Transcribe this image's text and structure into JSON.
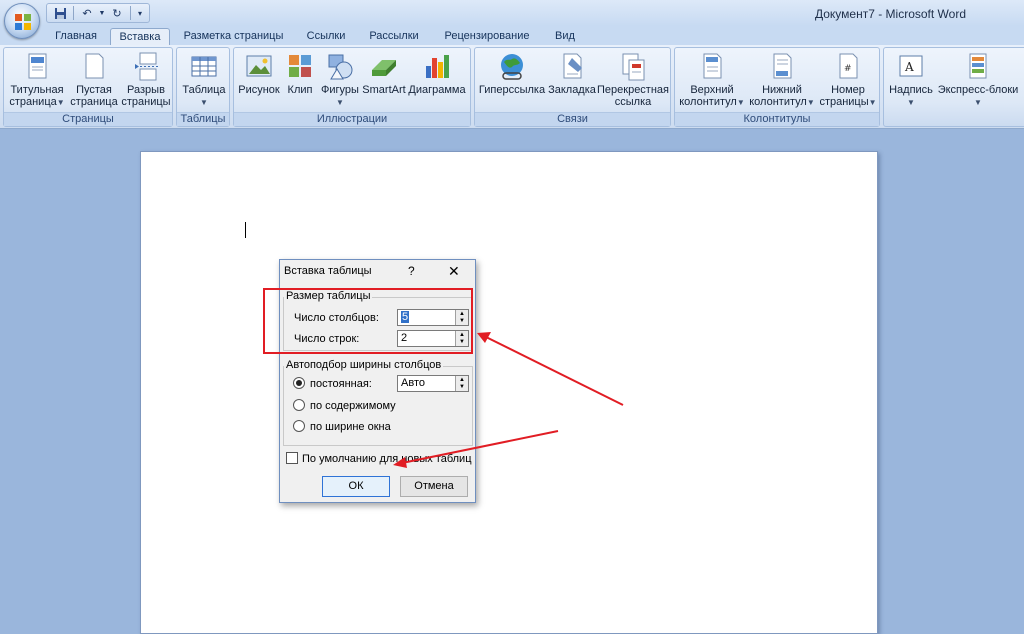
{
  "window": {
    "title": "Документ7 - Microsoft Word"
  },
  "qat": {
    "items": [
      "save-icon",
      "undo-icon",
      "redo-icon",
      "customize-icon"
    ]
  },
  "tabs": [
    {
      "label": "Главная"
    },
    {
      "label": "Вставка",
      "active": true
    },
    {
      "label": "Разметка страницы"
    },
    {
      "label": "Ссылки"
    },
    {
      "label": "Рассылки"
    },
    {
      "label": "Рецензирование"
    },
    {
      "label": "Вид"
    }
  ],
  "ribbon": {
    "groups": [
      {
        "label": "Страницы",
        "buttons": [
          {
            "line1": "Титульная",
            "line2": "страница",
            "icon": "cover-page-icon",
            "dropdown": true
          },
          {
            "line1": "Пустая",
            "line2": "страница",
            "icon": "blank-page-icon"
          },
          {
            "line1": "Разрыв",
            "line2": "страницы",
            "icon": "page-break-icon"
          }
        ]
      },
      {
        "label": "Таблицы",
        "buttons": [
          {
            "line1": "Таблица",
            "line2": "",
            "icon": "table-icon",
            "dropdown": true
          }
        ]
      },
      {
        "label": "Иллюстрации",
        "buttons": [
          {
            "line1": "Рисунок",
            "icon": "picture-icon"
          },
          {
            "line1": "Клип",
            "icon": "clip-icon"
          },
          {
            "line1": "Фигуры",
            "icon": "shapes-icon",
            "dropdown": true
          },
          {
            "line1": "SmartArt",
            "icon": "smartart-icon"
          },
          {
            "line1": "Диаграмма",
            "icon": "chart-icon"
          }
        ]
      },
      {
        "label": "Связи",
        "buttons": [
          {
            "line1": "Гиперссылка",
            "icon": "hyperlink-icon"
          },
          {
            "line1": "Закладка",
            "icon": "bookmark-icon"
          },
          {
            "line1": "Перекрестная",
            "line2": "ссылка",
            "icon": "cross-reference-icon"
          }
        ]
      },
      {
        "label": "Колонтитулы",
        "buttons": [
          {
            "line1": "Верхний",
            "line2": "колонтитул",
            "icon": "header-icon",
            "dropdown": true
          },
          {
            "line1": "Нижний",
            "line2": "колонтитул",
            "icon": "footer-icon",
            "dropdown": true
          },
          {
            "line1": "Номер",
            "line2": "страницы",
            "icon": "page-number-icon",
            "dropdown": true
          }
        ]
      },
      {
        "label": "",
        "buttons": [
          {
            "line1": "Надпись",
            "icon": "text-box-icon",
            "dropdown": true
          },
          {
            "line1": "Экспресс-блоки",
            "icon": "quick-parts-icon",
            "dropdown": true
          }
        ]
      }
    ]
  },
  "dialog": {
    "title": "Вставка таблицы",
    "help": "?",
    "close": "✕",
    "size_group": {
      "legend": "Размер таблицы",
      "columns_label": "Число столбцов:",
      "columns_value": "5",
      "rows_label": "Число строк:",
      "rows_value": "2"
    },
    "autofit_group": {
      "legend": "Автоподбор ширины столбцов",
      "fixed_label": "постоянная:",
      "fixed_value": "Авто",
      "content_label": "по содержимому",
      "window_label": "по ширине окна",
      "selected": "fixed"
    },
    "default_checkbox": {
      "label": "По умолчанию для новых таблиц",
      "checked": false
    },
    "ok_label": "ОК",
    "cancel_label": "Отмена"
  },
  "annotations": {
    "color": "#e11d24"
  }
}
